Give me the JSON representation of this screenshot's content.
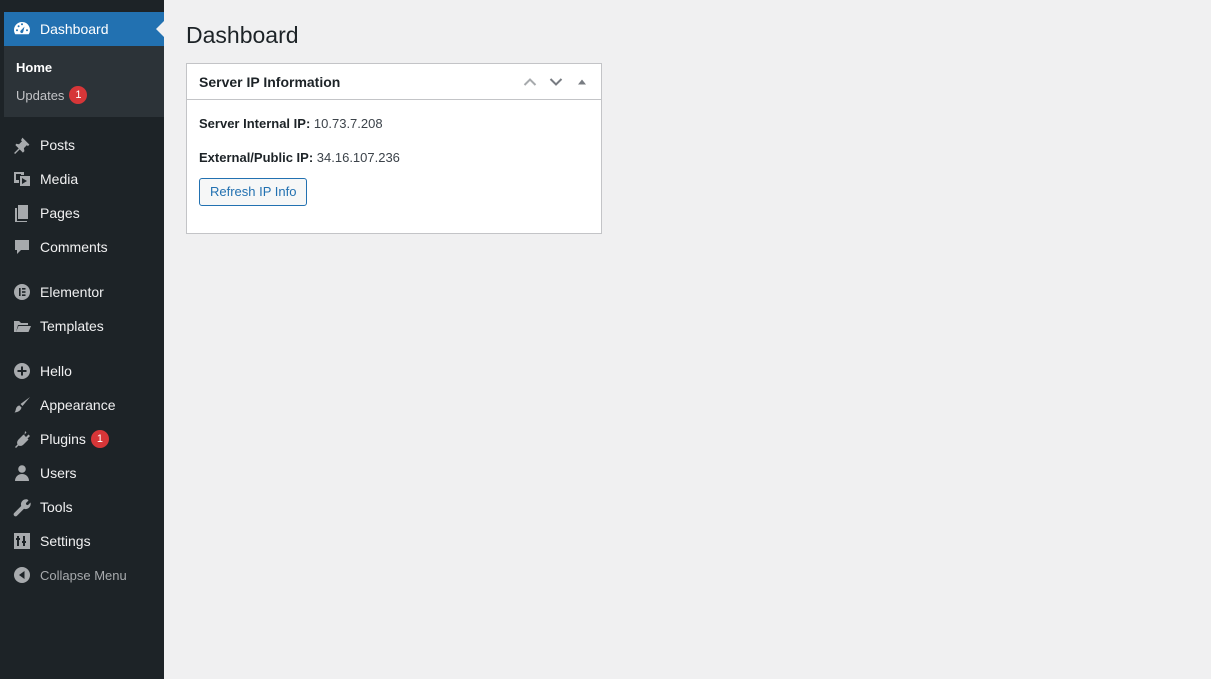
{
  "sidebar": {
    "dashboard": {
      "label": "Dashboard",
      "icon": "dashboard-icon"
    },
    "submenu": {
      "home": "Home",
      "updates": "Updates",
      "updates_count": "1"
    },
    "items": [
      {
        "key": "posts",
        "label": "Posts",
        "icon": "pin-icon"
      },
      {
        "key": "media",
        "label": "Media",
        "icon": "media-icon"
      },
      {
        "key": "pages",
        "label": "Pages",
        "icon": "pages-icon"
      },
      {
        "key": "comments",
        "label": "Comments",
        "icon": "comment-icon"
      },
      {
        "key": "elementor",
        "label": "Elementor",
        "icon": "elementor-icon"
      },
      {
        "key": "templates",
        "label": "Templates",
        "icon": "folder-icon"
      },
      {
        "key": "hello",
        "label": "Hello",
        "icon": "plus-circle-icon"
      },
      {
        "key": "appearance",
        "label": "Appearance",
        "icon": "paintbrush-icon"
      },
      {
        "key": "plugins",
        "label": "Plugins",
        "icon": "plugin-icon",
        "badge": "1"
      },
      {
        "key": "users",
        "label": "Users",
        "icon": "user-icon"
      },
      {
        "key": "tools",
        "label": "Tools",
        "icon": "wrench-icon"
      },
      {
        "key": "settings",
        "label": "Settings",
        "icon": "settings-icon"
      }
    ],
    "collapse": {
      "label": "Collapse Menu",
      "icon": "collapse-icon"
    }
  },
  "page": {
    "title": "Dashboard"
  },
  "widget": {
    "title": "Server IP Information",
    "internal_label": "Server Internal IP:",
    "internal_value": "10.73.7.208",
    "external_label": "External/Public IP:",
    "external_value": "34.16.107.236",
    "refresh_button": "Refresh IP Info"
  },
  "colors": {
    "sidebar_bg": "#1d2327",
    "submenu_bg": "#2c3338",
    "accent": "#2271b1",
    "badge": "#d63638",
    "page_bg": "#f0f0f1"
  }
}
